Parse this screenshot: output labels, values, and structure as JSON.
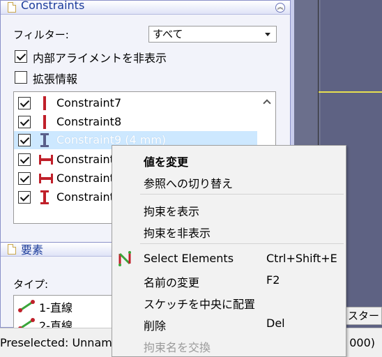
{
  "constraints_panel": {
    "title": "Constraints",
    "collapse_icon": "double-chevron-up-icon",
    "filter_label": "フィルター:",
    "filter_value": "すべて",
    "hide_internal_label": "内部アライメントを非表示",
    "hide_internal_checked": true,
    "extended_info_label": "拡張情報",
    "extended_info_checked": false,
    "items": [
      {
        "label": "Constraint7",
        "checked": true,
        "icon": "vertical-constraint-icon"
      },
      {
        "label": "Constraint8",
        "checked": true,
        "icon": "vertical-constraint-icon"
      },
      {
        "label": "Constraint9 (4 mm)",
        "checked": true,
        "icon": "vertical-distance-icon",
        "selected": true
      },
      {
        "label": "Constraint",
        "checked": true,
        "icon": "horizontal-distance-icon"
      },
      {
        "label": "Constraint",
        "checked": true,
        "icon": "horizontal-distance-icon"
      },
      {
        "label": "Constraint",
        "checked": true,
        "icon": "vertical-distance-icon"
      }
    ]
  },
  "elements_panel": {
    "title": "要素",
    "type_label": "タイプ:",
    "items": [
      {
        "label": "1-直線",
        "icon": "line-icon"
      },
      {
        "label": "2-直線",
        "icon": "line-icon"
      }
    ]
  },
  "view3d": {
    "tab_label": "スター"
  },
  "statusbar": {
    "text": "Preselected: Unname",
    "right_text": "000)"
  },
  "context_menu": {
    "items": [
      {
        "label": "値を変更",
        "bold": true
      },
      {
        "label": "参照への切り替え"
      },
      {
        "separator": true
      },
      {
        "label": "拘束を表示"
      },
      {
        "label": "拘束を非表示"
      },
      {
        "separator": true
      },
      {
        "label": "Select Elements",
        "shortcut": "Ctrl+Shift+E",
        "icon": "select-elements-icon"
      },
      {
        "label": "名前の変更",
        "shortcut": "F2"
      },
      {
        "label": "スケッチを中央に配置"
      },
      {
        "label": "削除",
        "shortcut": "Del"
      },
      {
        "label": "拘束名を交換",
        "disabled": true
      }
    ]
  },
  "colors": {
    "constraint_red": "#c0202a",
    "selection": "#cde8ff",
    "accent_title": "#1a3a9a",
    "line_green": "#3aa53a"
  }
}
